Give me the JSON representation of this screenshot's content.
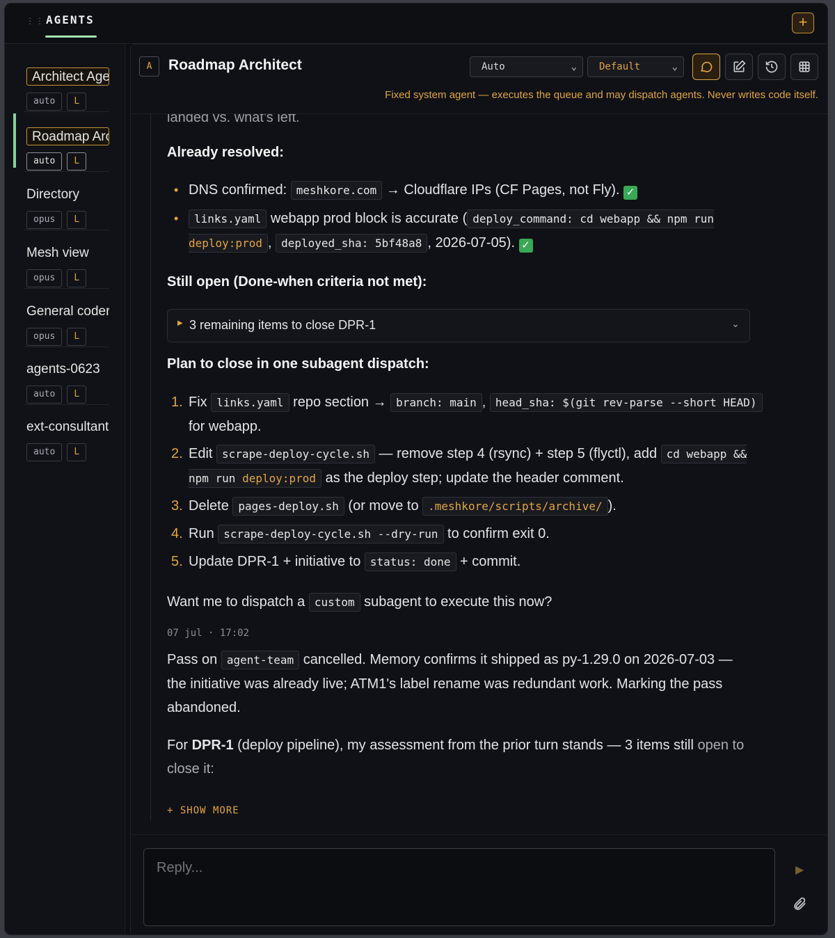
{
  "topbar": {
    "title": "AGENTS",
    "add_label": "+"
  },
  "sidebar": {
    "items": [
      {
        "name": "Architect Agent",
        "model": "auto",
        "badge": "L",
        "selected_outline": true,
        "active": false
      },
      {
        "name": "Roadmap Architect",
        "model": "auto",
        "badge": "L",
        "selected_outline": true,
        "active": true
      },
      {
        "name": "Directory",
        "model": "opus",
        "badge": "L"
      },
      {
        "name": "Mesh view",
        "model": "opus",
        "badge": "L"
      },
      {
        "name": "General coder",
        "model": "opus",
        "badge": "L"
      },
      {
        "name": "agents-0623",
        "model": "auto",
        "badge": "L"
      },
      {
        "name": "ext-consultant",
        "model": "auto",
        "badge": "L"
      }
    ]
  },
  "header": {
    "avatar": "A",
    "title": "Roadmap Architect",
    "mode_select": "Auto",
    "profile_select": "Default",
    "subtitle": "Fixed system agent — executes the queue and may dispatch agents. Never writes code itself."
  },
  "content": {
    "cut_line": "landed vs. what's left.",
    "resolved_heading": "Already resolved:",
    "resolved": {
      "b1_pre": "DNS confirmed: ",
      "b1_code": "meshkore.com",
      "b1_post": " → Cloudflare IPs (CF Pages, not Fly). ",
      "b2_code1": "links.yaml",
      "b2_mid": " webapp prod block is accurate (",
      "b2_code2a": "deploy_command: cd webapp && npm run ",
      "b2_code2b": "deploy:prod",
      "b2_sep": ", ",
      "b2_code3": "deployed_sha: 5bf48a8",
      "b2_post": ", 2026-07-05). ",
      "check": "✓"
    },
    "open_heading": "Still open (Done-when criteria not met):",
    "details_label": "3 remaining items to close DPR-1",
    "plan_heading": "Plan to close in one subagent dispatch:",
    "plan": {
      "s1_a": "Fix ",
      "s1_c1": "links.yaml",
      "s1_b": " repo section → ",
      "s1_c2": "branch: main",
      "s1_d": ", ",
      "s1_c3": "head_sha: $(git rev-parse --short HEAD)",
      "s1_e": " for webapp.",
      "s2_a": "Edit ",
      "s2_c1": "scrape-deploy-cycle.sh",
      "s2_b": " — remove step 4 (rsync) + step 5 (flyctl), add ",
      "s2_c2a": "cd webapp && npm run ",
      "s2_c2b": "deploy:prod",
      "s2_e": " as the deploy step; update the header comment.",
      "s3_a": "Delete ",
      "s3_c1": "pages-deploy.sh",
      "s3_b": " (or move to ",
      "s3_c2": ".meshkore/scripts/archive/",
      "s3_e": ").",
      "s4_a": "Run ",
      "s4_c1": "scrape-deploy-cycle.sh --dry-run",
      "s4_e": " to confirm exit 0.",
      "s5_a": "Update DPR-1 + initiative to ",
      "s5_c1": "status: done",
      "s5_e": " + commit."
    },
    "question_a": "Want me to dispatch a ",
    "question_code": "custom",
    "question_b": " subagent to execute this now?",
    "timestamp": "07 jul · 17:02",
    "pass_a": "Pass on ",
    "pass_code": "agent-team",
    "pass_b": " cancelled. Memory confirms it shipped as py-1.29.0 on 2026-07-03 — the initiative was already live; ATM1's label rename was redundant work. Marking the pass abandoned.",
    "for_a": "For ",
    "for_bold": "DPR-1",
    "for_b": " (deploy pipeline), my assessment from the prior turn stands — 3 items still ",
    "for_fade": "open to close it:",
    "show_more": "+ SHOW MORE"
  },
  "composer": {
    "placeholder": "Reply..."
  },
  "colors": {
    "accent": "#e3a442",
    "active_bar": "#7fd49a",
    "check": "#3aa857"
  }
}
